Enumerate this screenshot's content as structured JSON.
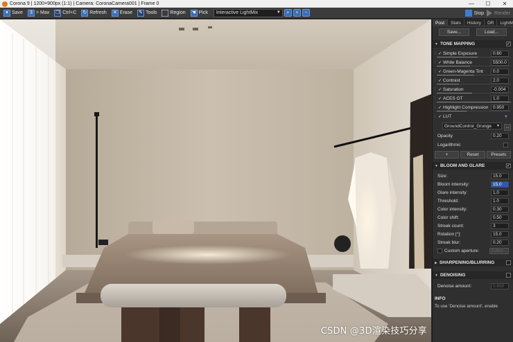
{
  "window": {
    "title": "Corona 9 | 1200×900px (1:1) | Camera: CoronaCamera001 | Frame 0",
    "minimize": "—",
    "maximize": "☐",
    "close": "✕"
  },
  "toolbar": {
    "save": "Save",
    "max": "> Max",
    "copy": "Ctrl+C",
    "refresh": "Refresh",
    "erase": "Erase",
    "tools": "Tools",
    "region": "Region",
    "pick": "Pick",
    "view_mode": "Interactive LightMix",
    "stop": "Stop",
    "render": "Render"
  },
  "panel": {
    "tabs": [
      "Post",
      "Stats",
      "History",
      "DR",
      "LightMix"
    ],
    "save_btn": "Save...",
    "load_btn": "Load...",
    "tone_mapping": {
      "header": "TONE MAPPING",
      "rows": [
        {
          "label": "Simple Exposure",
          "value": "0.60"
        },
        {
          "label": "White Balance",
          "value": "5500.0"
        },
        {
          "label": "Green-Magenta Tint",
          "value": "0.0"
        },
        {
          "label": "Contrast",
          "value": "2.0"
        },
        {
          "label": "Saturation",
          "value": "-0.004"
        },
        {
          "label": "ACES OT",
          "value": "1.0"
        },
        {
          "label": "Highlight Compression",
          "value": "0.950"
        }
      ],
      "lut_label": "LUT",
      "lut_value": "GroundControl_Grunge",
      "lut_more": "...",
      "opacity_label": "Opacity",
      "opacity_value": "0.20",
      "logarithmic_label": "Logarithmic",
      "plus": "+",
      "reset": "Reset",
      "presets": "Presets"
    },
    "bloom": {
      "header": "BLOOM AND GLARE",
      "rows": [
        {
          "label": "Size:",
          "value": "15.0"
        },
        {
          "label": "Bloom intensity:",
          "value": "15.0"
        },
        {
          "label": "Glare intensity:",
          "value": "1.0"
        },
        {
          "label": "Threshold:",
          "value": "1.0"
        },
        {
          "label": "Color intensity:",
          "value": "0.30"
        },
        {
          "label": "Color shift:",
          "value": "0.50"
        },
        {
          "label": "Streak count:",
          "value": "3"
        },
        {
          "label": "Rotation [°]:",
          "value": "15.0"
        },
        {
          "label": "Streak blur:",
          "value": "0.20"
        }
      ],
      "custom_aperture": "Custom aperture:",
      "editor": "Editor..."
    },
    "sharpening": {
      "header": "SHARPENING/BLURRING"
    },
    "denoising": {
      "header": "DENOISING",
      "amount_label": "Denoise amount:",
      "amount_value": "0.650"
    },
    "info": {
      "header": "INFO",
      "text": "To use 'Denoise amount', enable"
    }
  },
  "watermark": "CSDN @3D渲染技巧分享",
  "colors": {
    "accent": "#3a6db5",
    "panel_bg": "#2f2f2f",
    "highlight": "#2a5db0"
  }
}
